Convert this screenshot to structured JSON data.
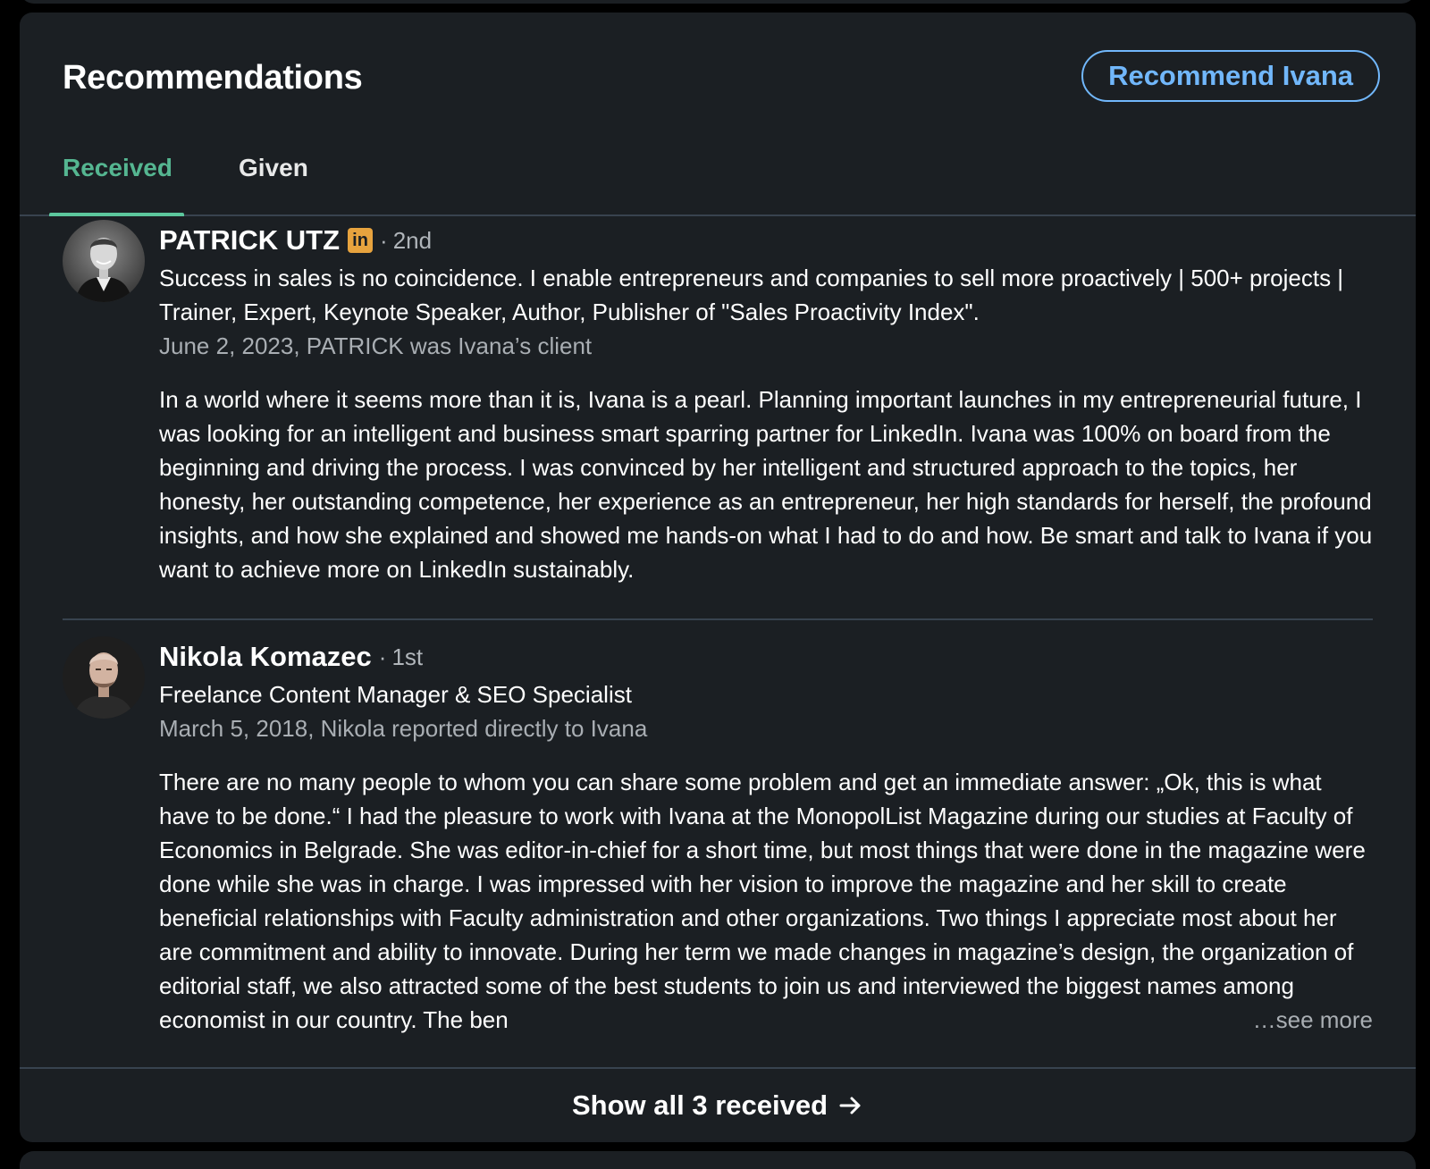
{
  "header": {
    "title": "Recommendations",
    "recommend_button": "Recommend Ivana"
  },
  "tabs": [
    {
      "label": "Received",
      "active": true
    },
    {
      "label": "Given",
      "active": false
    }
  ],
  "recommendations": [
    {
      "name": "PATRICK UTZ",
      "badge_icon": "linkedin-premium-icon",
      "badge_text": "in",
      "separator": "·",
      "degree": "2nd",
      "headline": "Success in sales is no coincidence. I enable entrepreneurs and companies to sell more proactively | 500+ projects | Trainer, Expert, Keynote Speaker, Author, Publisher of \"Sales Proactivity Index\".",
      "meta": "June 2, 2023, PATRICK was Ivana’s client",
      "text": "In a world where it seems more than it is, Ivana is a pearl. Planning important launches in my entrepreneurial future, I was looking for an intelligent and business smart sparring partner for LinkedIn. Ivana was 100% on board from the beginning and driving the process. I was convinced by her intelligent and structured approach to the topics, her honesty, her outstanding competence, her experience as an entrepreneur, her high standards for herself, the profound insights, and how she explained and showed me hands-on what I had to do and how. Be smart and talk to Ivana if you want to achieve more on LinkedIn sustainably."
    },
    {
      "name": "Nikola Komazec",
      "separator": "·",
      "degree": "1st",
      "headline": "Freelance Content Manager & SEO Specialist",
      "meta": "March 5, 2018, Nikola reported directly to Ivana",
      "text": "There are no many people to whom you can share some problem and get an immediate answer: „Ok, this is what have to be done.“ I had the pleasure to work with Ivana at the MonopolList Magazine during our studies at Faculty of Economics in Belgrade. She was editor-in-chief for a short time, but most things that were done in the magazine were done while she was in charge. I was impressed with her vision to improve the magazine and her skill to create beneficial relationships with Faculty administration and other organizations. Two things I appreciate most about her are commitment and ability to innovate. During her term we made changes in magazine’s design, the organization of editorial staff, we also attracted some of the best students to join us and interviewed the biggest names among economist in our country. The ben",
      "see_more": "…see more"
    }
  ],
  "footer": {
    "label": "Show all 3 received",
    "icon": "arrow-right-icon"
  },
  "colors": {
    "background": "#1b1f23",
    "accent_green": "#5cc79d",
    "accent_blue": "#71b7fb",
    "muted_text": "#a9aeb3",
    "divider": "#38434f"
  }
}
